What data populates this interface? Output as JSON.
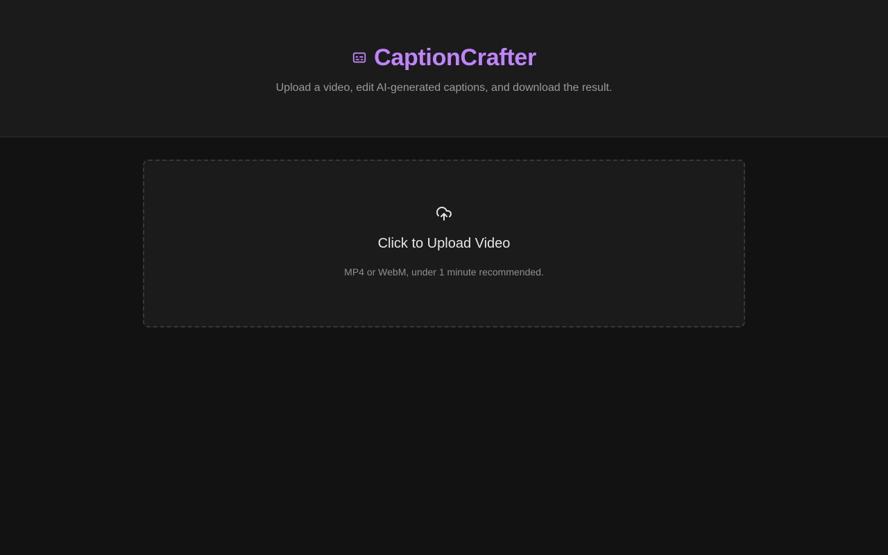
{
  "header": {
    "title": "CaptionCrafter",
    "subtitle": "Upload a video, edit AI-generated captions, and download the result.",
    "logo_icon": "captions-icon"
  },
  "upload": {
    "title": "Click to Upload Video",
    "hint": "MP4 or WebM, under 1 minute recommended.",
    "icon": "cloud-upload-icon"
  },
  "colors": {
    "accent": "#c084fc",
    "background": "#121212",
    "surface": "#1b1b1b",
    "border": "#383838"
  }
}
